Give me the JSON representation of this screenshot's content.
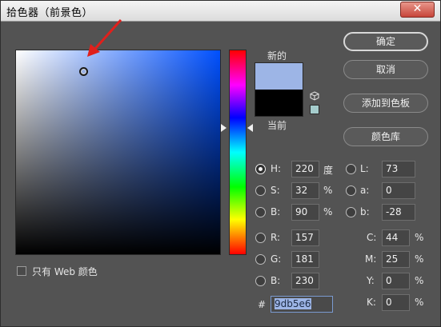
{
  "window": {
    "title": "拾色器（前景色）",
    "close_icon": "close-icon"
  },
  "swatches": {
    "new_label": "新的",
    "current_label": "当前",
    "new_color": "#9db5e6",
    "current_color": "#000000",
    "websafe_color": "#a5cccc"
  },
  "buttons": {
    "ok": "确定",
    "cancel": "取消",
    "add_to_swatches": "添加到色板",
    "color_libraries": "颜色库"
  },
  "hsb": {
    "h": {
      "label": "H:",
      "value": "220",
      "unit": "度"
    },
    "s": {
      "label": "S:",
      "value": "32",
      "unit": "%"
    },
    "b": {
      "label": "B:",
      "value": "90",
      "unit": "%"
    }
  },
  "rgb": {
    "r": {
      "label": "R:",
      "value": "157"
    },
    "g": {
      "label": "G:",
      "value": "181"
    },
    "b": {
      "label": "B:",
      "value": "230"
    }
  },
  "lab": {
    "l": {
      "label": "L:",
      "value": "73"
    },
    "a": {
      "label": "a:",
      "value": "0"
    },
    "b": {
      "label": "b:",
      "value": "-28"
    }
  },
  "cmyk": {
    "c": {
      "label": "C:",
      "value": "44",
      "unit": "%"
    },
    "m": {
      "label": "M:",
      "value": "25",
      "unit": "%"
    },
    "y": {
      "label": "Y:",
      "value": "0",
      "unit": "%"
    },
    "k": {
      "label": "K:",
      "value": "0",
      "unit": "%"
    }
  },
  "hex": {
    "label": "#",
    "value": "9db5e6"
  },
  "web_only": {
    "label": "只有 Web 颜色",
    "checked": false
  },
  "colors": {
    "annotation_arrow": "#e0201c",
    "field_hue": "#0050ff"
  }
}
